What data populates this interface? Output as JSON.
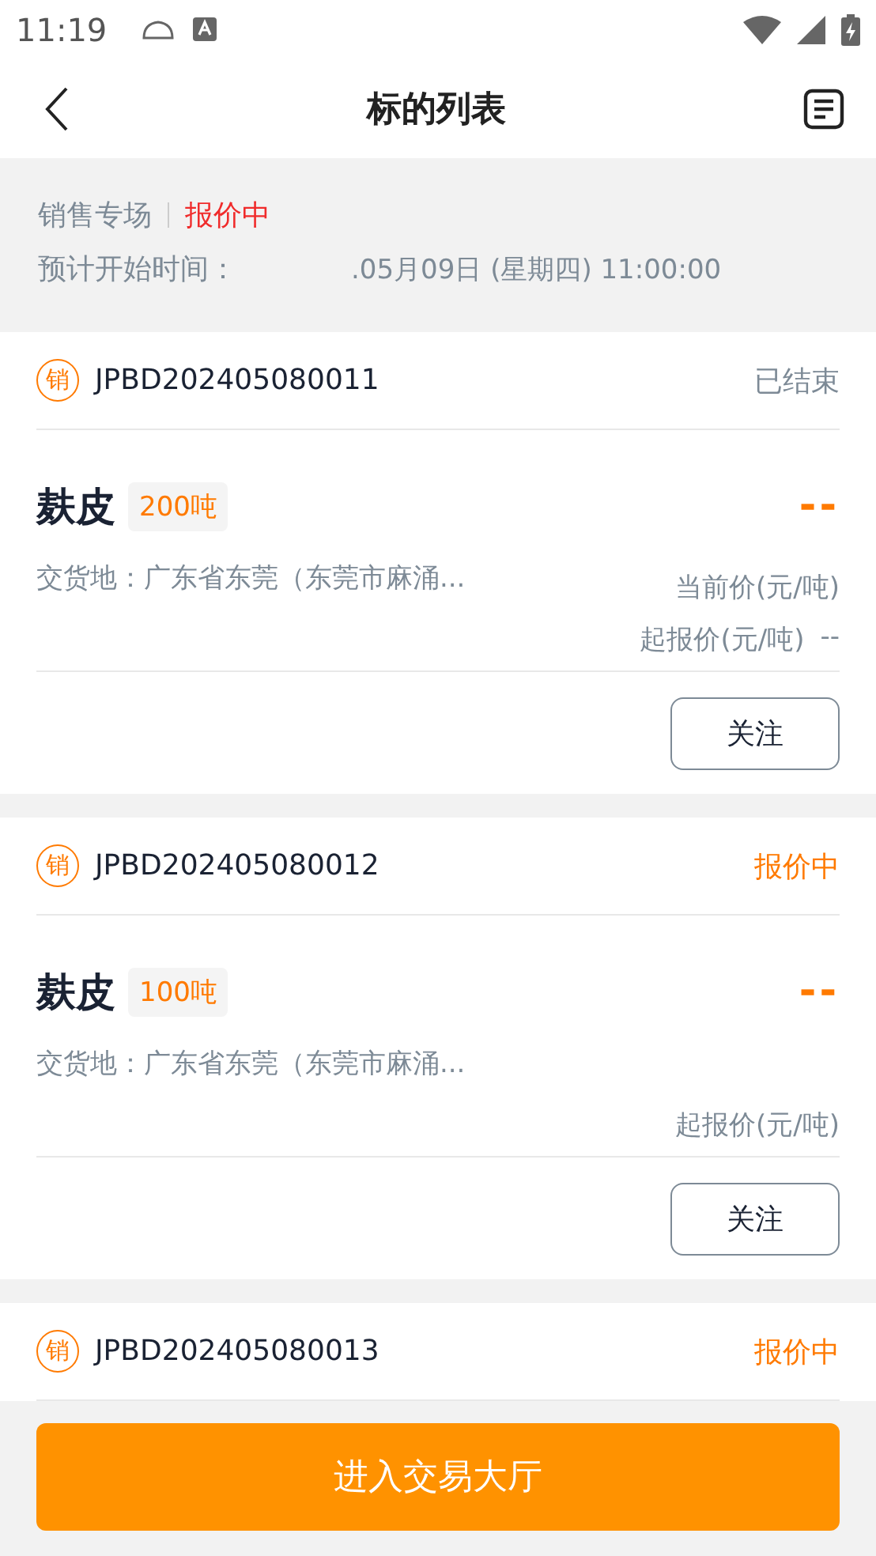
{
  "status_bar": {
    "time": "11:19"
  },
  "header": {
    "title": "标的列表"
  },
  "session": {
    "name": "销售专场",
    "status": "报价中",
    "start_label": "预计开始时间：",
    "start_time": ".05月09日 (星期四) 11:00:00"
  },
  "lots": [
    {
      "badge": "销",
      "code": "JPBD202405080011",
      "status": "已结束",
      "ended": true,
      "name": "麸皮",
      "quantity": "200吨",
      "price": "--",
      "location": "交货地：广东省东莞（东莞市麻涌...",
      "current_price_label": "当前价(元/吨)",
      "start_price_label": "起报价(元/吨)",
      "start_price_value": "--",
      "button": "关注"
    },
    {
      "badge": "销",
      "code": "JPBD202405080012",
      "status": "报价中",
      "ended": false,
      "name": "麸皮",
      "quantity": "100吨",
      "price": "--",
      "location": "交货地：广东省东莞（东莞市麻涌...",
      "start_price_label": "起报价(元/吨)",
      "button": "关注"
    },
    {
      "badge": "销",
      "code": "JPBD202405080013",
      "status": "报价中",
      "ended": false
    }
  ],
  "enter_button": "进入交易大厅"
}
